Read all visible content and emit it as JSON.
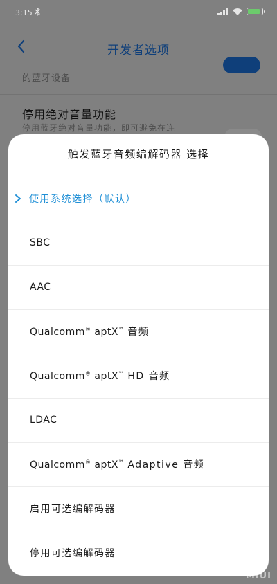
{
  "status_bar": {
    "time": "3:15"
  },
  "nav": {
    "title": "开发者选项"
  },
  "background": {
    "item1_sub": "的蓝牙设备",
    "item2_title": "停用绝对音量功能",
    "item2_sub": "停用蓝牙绝对音量功能，即可避免在连"
  },
  "dialog": {
    "title": "触发蓝牙音频编解码器 选择",
    "options": [
      {
        "label": "使用系统选择（默认）",
        "selected": true
      },
      {
        "label": "SBC"
      },
      {
        "label": "AAC"
      },
      {
        "brand": "Qualcomm",
        "reg": "®",
        "product": "aptX",
        "tm": "™",
        "suffix": "音频"
      },
      {
        "brand": "Qualcomm",
        "reg": "®",
        "product": "aptX",
        "tm": "™",
        "suffix": "HD 音频"
      },
      {
        "label": "LDAC"
      },
      {
        "brand": "Qualcomm",
        "reg": "®",
        "product": "aptX",
        "tm": "™",
        "suffix": "Adaptive 音频"
      },
      {
        "label": "启用可选编解码器"
      },
      {
        "label": "停用可选编解码器"
      }
    ]
  },
  "watermark": "MIUI",
  "colors": {
    "accent": "#1f8fd6",
    "title_blue": "#0f3f7a",
    "dim_bg": "#808080"
  }
}
